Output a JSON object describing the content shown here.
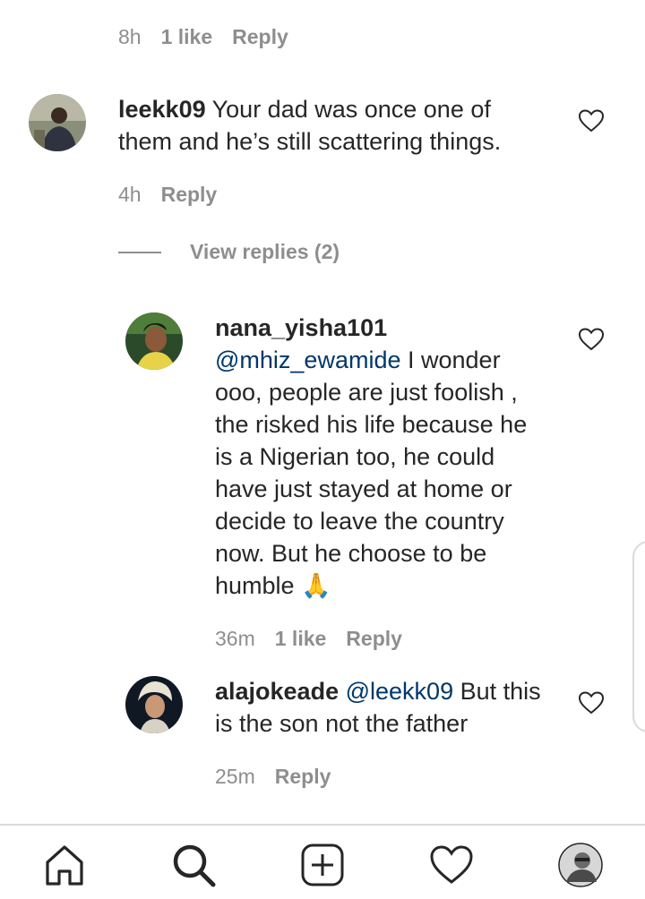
{
  "top_meta": {
    "time": "8h",
    "likes": "1 like",
    "reply": "Reply"
  },
  "comments": [
    {
      "username": "leekk09",
      "text": "Your dad was once one of them and he’s still scattering things.",
      "text_line1": "Your dad was once one of",
      "text_line2": "them and he’s still scattering things.",
      "time": "4h",
      "reply": "Reply"
    }
  ],
  "view_replies": "View replies (2)",
  "replies": [
    {
      "username": "nana_yisha101",
      "mention": "@mhiz_ewamide",
      "lines": [
        "I wonder",
        "ooo, people are just foolish ,",
        "the risked his life because he",
        "is a Nigerian too, he could",
        "have just stayed at home or",
        "decide to leave the country",
        "now. But he choose to be",
        "humble 🙏"
      ],
      "time": "36m",
      "likes": "1 like",
      "reply": "Reply"
    },
    {
      "username": "alajokeade",
      "mention": "@leekk09",
      "line1_rest": "But this",
      "line2": "is the son not the father",
      "time": "25m",
      "reply": "Reply"
    }
  ],
  "nav": {
    "items": [
      "home-icon",
      "search-icon",
      "new-post-icon",
      "activity-heart-icon",
      "profile-avatar"
    ]
  }
}
